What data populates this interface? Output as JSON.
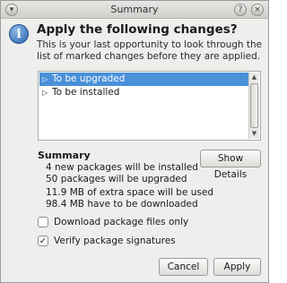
{
  "window": {
    "title": "Summary",
    "menu_icon": "window-menu-icon",
    "help_icon": "help-icon",
    "close_icon": "close-icon"
  },
  "dialog": {
    "icon": "info-icon",
    "heading": "Apply the following changes?",
    "intro": "This is your last opportunity to look through the list of marked changes before they are applied."
  },
  "changes_list": {
    "items": [
      {
        "label": "To be upgraded",
        "selected": true
      },
      {
        "label": "To be installed",
        "selected": false
      }
    ]
  },
  "summary": {
    "title": "Summary",
    "show_details_label": "Show Details",
    "lines": [
      "4 new packages will be installed",
      "50 packages will be upgraded",
      "11.9 MB of extra space will be used",
      "98.4 MB have to be downloaded"
    ]
  },
  "options": {
    "download_only": {
      "label": "Download package files only",
      "checked": false
    },
    "verify_signatures": {
      "label": "Verify package signatures",
      "checked": true
    }
  },
  "buttons": {
    "cancel": "Cancel",
    "apply": "Apply"
  },
  "colors": {
    "selection": "#4a90d9",
    "info_icon": "#2b64ad"
  }
}
